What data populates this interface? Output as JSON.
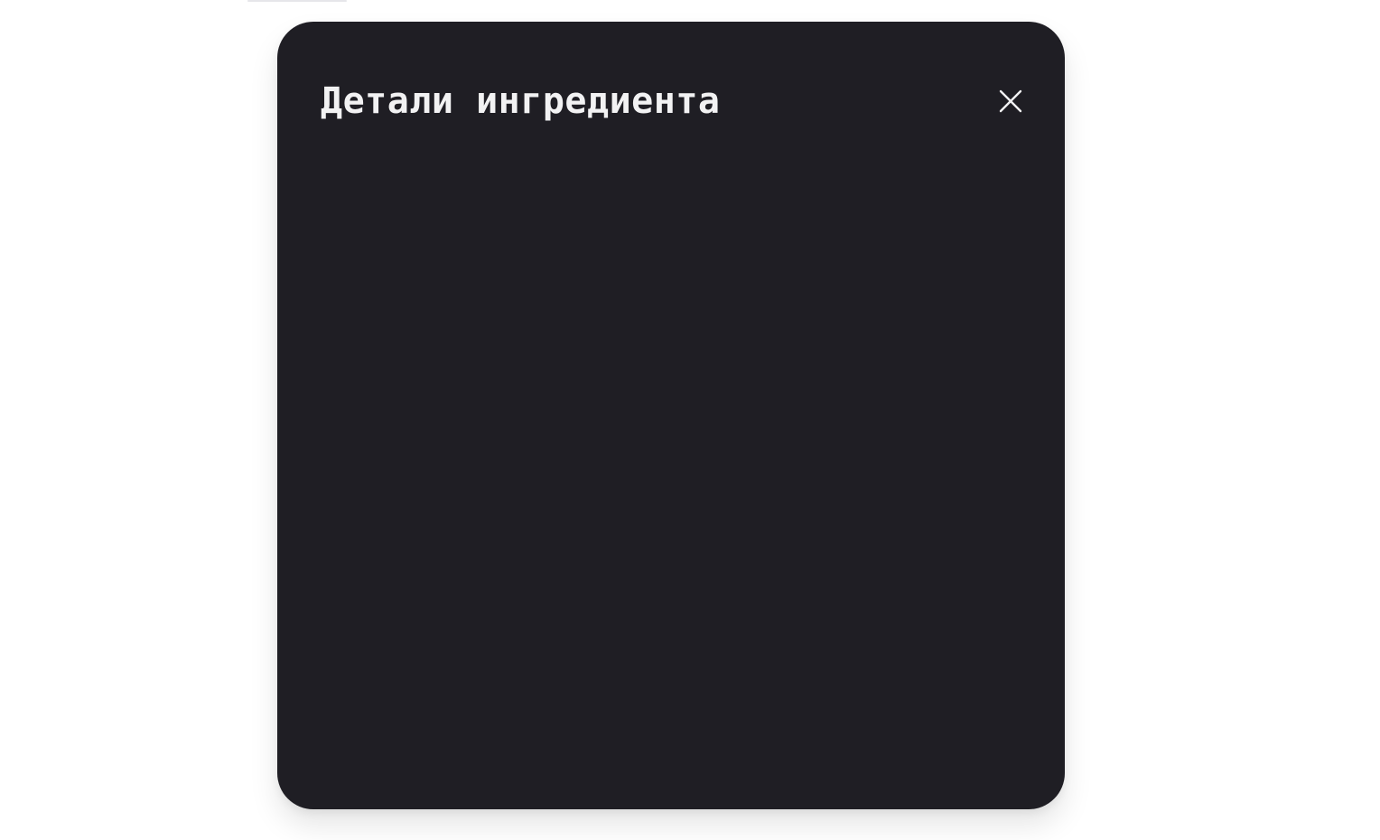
{
  "modal": {
    "title": "Детали ингредиента",
    "close_icon": "close-icon"
  },
  "colors": {
    "page_background": "#ffffff",
    "modal_background": "#1f1e24",
    "title_text": "#f2f2f3",
    "close_icon": "#f2f2f3"
  }
}
